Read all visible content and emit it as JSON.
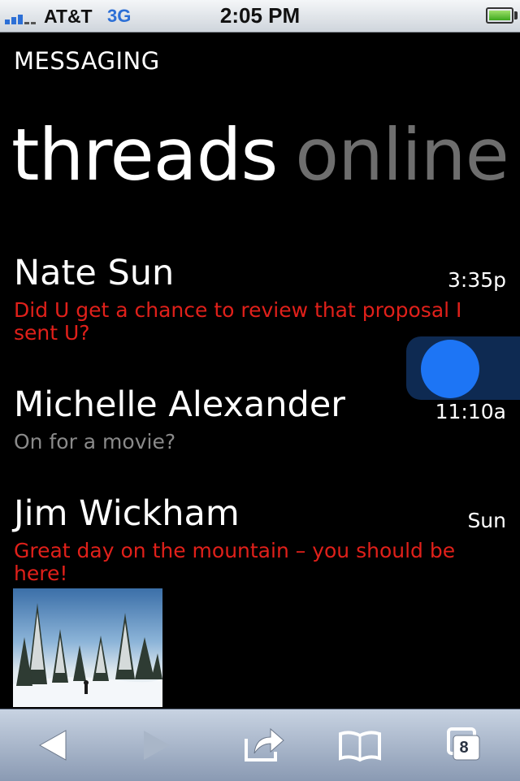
{
  "status_bar": {
    "carrier": "AT&T",
    "network": "3G",
    "time": "2:05 PM"
  },
  "app": {
    "label": "MESSAGING",
    "pivot": {
      "current": "threads",
      "next": "online"
    }
  },
  "threads": [
    {
      "name": "Nate Sun",
      "time": "3:35p",
      "preview": "Did U get a chance to review that proposal I sent U?",
      "unread": true
    },
    {
      "name": "Michelle Alexander",
      "time": "11:10a",
      "preview": "On for a movie?",
      "unread": false
    },
    {
      "name": "Jim Wickham",
      "time": "Sun",
      "preview": "Great day on the mountain – you should be here!",
      "unread": true,
      "has_photo": true
    }
  ],
  "toolbar": {
    "tabs_count": "8",
    "buttons": [
      "back-icon",
      "forward-icon",
      "share-icon",
      "bookmarks-icon",
      "tabs-icon"
    ]
  },
  "colors": {
    "unread_preview": "#e0201a",
    "read_preview": "#8a8a8a",
    "pivot_inactive": "#6e6e6e",
    "accent": "#1d75f5"
  }
}
